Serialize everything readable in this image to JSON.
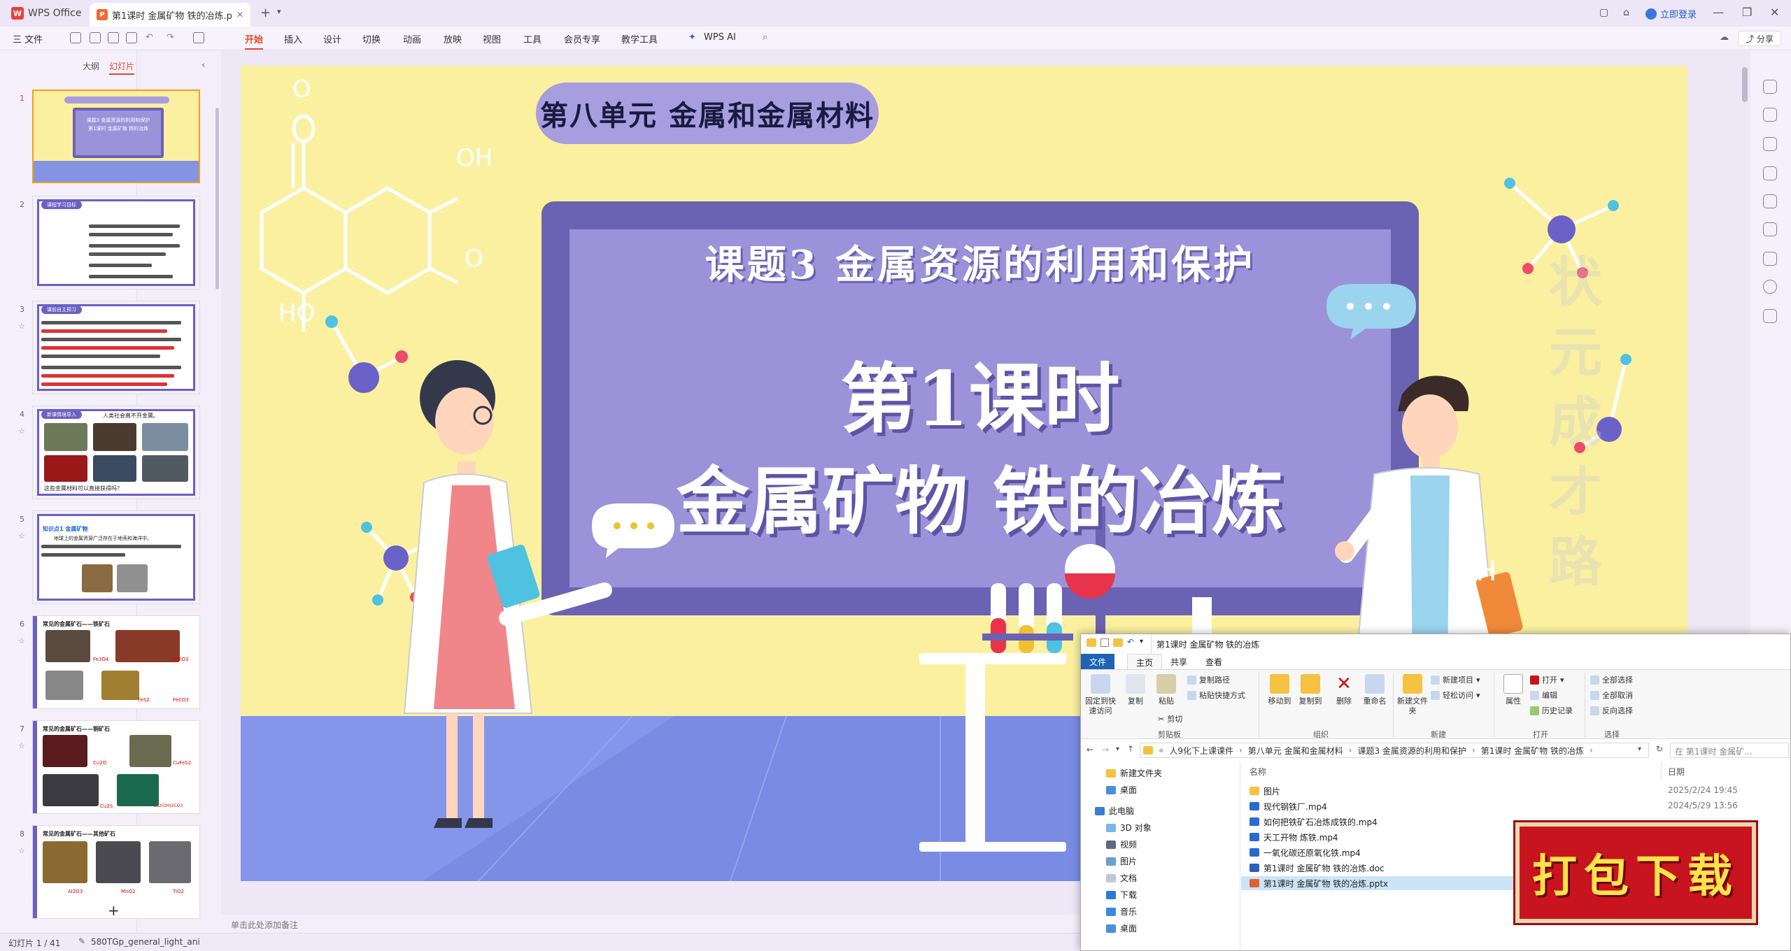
{
  "titlebar": {
    "app_name": "WPS Office",
    "doc_tab": "第1课时 金属矿物 铁的冶炼.p",
    "login": "立即登录"
  },
  "ribbon": {
    "file_menu": "三 文件",
    "tabs": [
      "开始",
      "插入",
      "设计",
      "切换",
      "动画",
      "放映",
      "视图",
      "工具",
      "会员专享",
      "教学工具"
    ],
    "active_tab": "开始",
    "wps_ai": "WPS AI",
    "share": "分享"
  },
  "left_panel": {
    "tabs": [
      "大纲",
      "幻灯片"
    ],
    "active_tab": "幻灯片",
    "slide_numbers": [
      "1",
      "2",
      "3",
      "4",
      "5",
      "6",
      "7",
      "8"
    ],
    "thumbs": [
      {
        "title": "课题3 金属资源的利用和保护",
        "subtitle": "第1课时 金属矿物 铁的冶炼"
      },
      {
        "title": "课程学习目标"
      },
      {
        "title": "课前自主预习"
      },
      {
        "title": "新课情境导入",
        "caption": "人类社会离不开金属。",
        "caption2": "这些金属材料可以直接获得吗？"
      },
      {
        "title": "知识点1 金属矿物",
        "caption": "地球上的金属资源广泛存在于地壳和海洋中。"
      },
      {
        "title": "常见的金属矿石——铁矿石",
        "labels": [
          "Fe3O4",
          "Fe2O3",
          "FeS2",
          "FeCO3"
        ]
      },
      {
        "title": "常见的金属矿石——铜矿石",
        "labels": [
          "Cu2O",
          "CuFeS2",
          "Cu2S",
          "Cu2(OH)2CO3"
        ]
      },
      {
        "title": "常见的金属矿石——其他矿石",
        "labels": [
          "Al2O3",
          "MnO2",
          "TiO2"
        ]
      }
    ]
  },
  "slide": {
    "unit_title": "第八单元  金属和金属材料",
    "topic": "课题3 金属资源的利用和保护",
    "lesson": "第1课时",
    "subtitle": "金属矿物  铁的冶炼",
    "oh_top": "OH",
    "o_right": "O",
    "o_top": "O",
    "ho_bottom": "HO",
    "oh_right": "OH",
    "watermark": "状元成才路"
  },
  "notes_placeholder": "单击此处添加备注",
  "statusbar": {
    "slide_counter": "幻灯片 1 / 41",
    "theme": "580TGp_general_light_ani"
  },
  "explorer": {
    "title": "第1课时 金属矿物 铁的冶炼",
    "tabs": [
      "文件",
      "主页",
      "共享",
      "查看"
    ],
    "ribbon": {
      "pin": "固定到快速访问",
      "copy": "复制",
      "paste": "粘贴",
      "copy_path": "复制路径",
      "paste_shortcut": "粘贴快捷方式",
      "cut": "剪切",
      "group_clipboard": "剪贴板",
      "move_to": "移动到",
      "copy_to": "复制到",
      "delete": "删除",
      "rename": "重命名",
      "group_organize": "组织",
      "new_folder": "新建文件夹",
      "new_item": "新建项目",
      "easy_access": "轻松访问",
      "group_new": "新建",
      "properties": "属性",
      "open": "打开",
      "edit": "编辑",
      "history": "历史记录",
      "group_open": "打开",
      "select_all": "全部选择",
      "select_none": "全部取消",
      "invert": "反向选择",
      "group_select": "选择"
    },
    "path": [
      "人9化下上课课件",
      "第八单元 金属和金属材料",
      "课题3 金属资源的利用和保护",
      "第1课时 金属矿物 铁的冶炼"
    ],
    "search_placeholder": "在 第1课时 金属矿...",
    "nav": [
      "新建文件夹",
      "桌面",
      "此电脑",
      "3D 对象",
      "视频",
      "图片",
      "文档",
      "下载",
      "音乐",
      "桌面"
    ],
    "columns": {
      "name": "名称",
      "date": "日期"
    },
    "files": [
      {
        "name": "图片",
        "date": "2025/2/24 19:45",
        "type": "folder"
      },
      {
        "name": "现代钢铁厂.mp4",
        "date": "2024/5/29 13:56",
        "type": "video"
      },
      {
        "name": "如何把铁矿石冶炼成铁的.mp4",
        "date": "",
        "type": "video"
      },
      {
        "name": "天工开物 炼铁.mp4",
        "date": "",
        "type": "video"
      },
      {
        "name": "一氧化碳还原氧化铁.mp4",
        "date": "",
        "type": "video"
      },
      {
        "name": "第1课时 金属矿物 铁的冶炼.doc",
        "date": "",
        "type": "doc"
      },
      {
        "name": "第1课时 金属矿物 铁的冶炼.pptx",
        "date": "",
        "type": "pptx"
      }
    ]
  },
  "download_badge": "打包下载",
  "colors": {
    "accent": "#e5462f",
    "slide_bg": "#faf0a0",
    "board_frame": "#6a62b2",
    "board_inner": "#9b92da",
    "unit_pill": "#a79ddf",
    "floor": "#7e8ee6",
    "badge_red": "#c8141e",
    "badge_text": "#ffe34a"
  }
}
